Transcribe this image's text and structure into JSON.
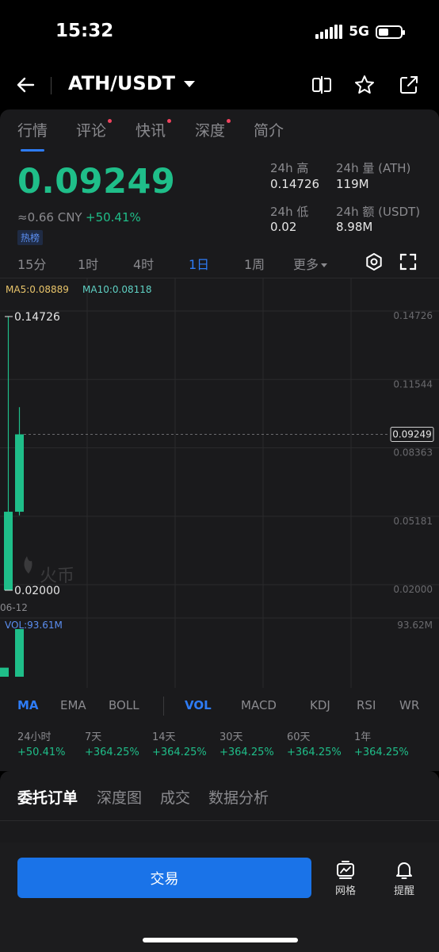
{
  "status": {
    "time": "15:32",
    "network": "5G",
    "battery_level": 0.45
  },
  "header": {
    "pair": "ATH/USDT"
  },
  "tabs": [
    {
      "label": "行情",
      "active": true,
      "dot": false
    },
    {
      "label": "评论",
      "active": false,
      "dot": true
    },
    {
      "label": "快讯",
      "active": false,
      "dot": true
    },
    {
      "label": "深度",
      "active": false,
      "dot": true
    },
    {
      "label": "简介",
      "active": false,
      "dot": false
    }
  ],
  "ticker": {
    "price": "0.09249",
    "cny": "≈0.66 CNY",
    "change": "+50.41%",
    "badge": "热榜",
    "high_label": "24h 高",
    "high": "0.14726",
    "low_label": "24h 低",
    "low": "0.02",
    "vol_label": "24h 量 (ATH)",
    "vol": "119M",
    "amt_label": "24h 额 (USDT)",
    "amt": "8.98M"
  },
  "periods": [
    {
      "label": "15分",
      "active": false
    },
    {
      "label": "1时",
      "active": false
    },
    {
      "label": "4时",
      "active": false
    },
    {
      "label": "1日",
      "active": true
    },
    {
      "label": "1周",
      "active": false
    }
  ],
  "more_label": "更多",
  "chart_data": {
    "type": "candlestick",
    "ma5_label": "MA5:0.08889",
    "ma10_label": "MA10:0.08118",
    "y_ticks": [
      "0.14726",
      "0.11544",
      "0.08363",
      "0.05181",
      "0.02000"
    ],
    "ylim": [
      0.02,
      0.14726
    ],
    "current_price": "0.09249",
    "current_value": 0.09249,
    "max_label": "0.14726",
    "min_label": "0.02000",
    "date_label": "06-12",
    "volume_label": "VOL:93.61M",
    "volume_max": "93.62M",
    "candles": [
      {
        "open": 0.02,
        "high": 0.14726,
        "low": 0.02,
        "close": 0.0565
      },
      {
        "open": 0.0565,
        "high": 0.1051,
        "low": 0.0548,
        "close": 0.09249
      }
    ],
    "volumes": [
      0.19,
      1.0
    ],
    "colors": {
      "up": "#1fbe89",
      "ma5": "#e8c46a",
      "ma10": "#5fd1c4"
    },
    "watermark": "火币"
  },
  "indicators": [
    {
      "label": "MA",
      "active": true
    },
    {
      "label": "EMA",
      "active": false
    },
    {
      "label": "BOLL",
      "active": false
    },
    {
      "label": "VOL",
      "active": true
    },
    {
      "label": "MACD",
      "active": false
    },
    {
      "label": "KDJ",
      "active": false
    },
    {
      "label": "RSI",
      "active": false
    },
    {
      "label": "WR",
      "active": false
    }
  ],
  "performance": [
    {
      "label": "24小时",
      "value": "+50.41%"
    },
    {
      "label": "7天",
      "value": "+364.25%"
    },
    {
      "label": "14天",
      "value": "+364.25%"
    },
    {
      "label": "30天",
      "value": "+364.25%"
    },
    {
      "label": "60天",
      "value": "+364.25%"
    },
    {
      "label": "1年",
      "value": "+364.25%"
    }
  ],
  "bottom_tabs": [
    {
      "label": "委托订单",
      "active": true
    },
    {
      "label": "深度图",
      "active": false
    },
    {
      "label": "成交",
      "active": false
    },
    {
      "label": "数据分析",
      "active": false
    }
  ],
  "actions": {
    "trade": "交易",
    "grid": "网格",
    "alert": "提醒"
  }
}
